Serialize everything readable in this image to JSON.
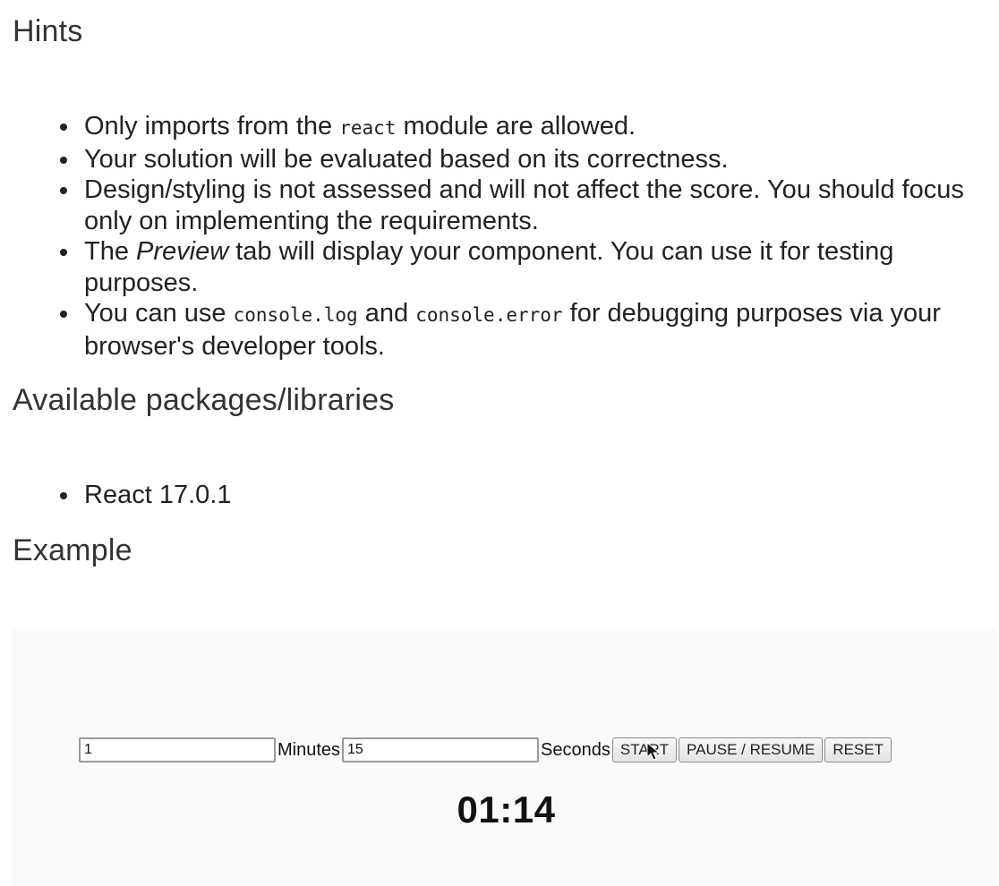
{
  "sections": {
    "hints_title": "Hints",
    "packages_title": "Available packages/libraries",
    "example_title": "Example"
  },
  "hints": {
    "item1": {
      "before": "Only imports from the ",
      "code": "react",
      "after": " module are allowed."
    },
    "item2": {
      "text": "Your solution will be evaluated based on its correctness."
    },
    "item3": {
      "text": "Design/styling is not assessed and will not affect the score. You should focus only on implementing the requirements."
    },
    "item4": {
      "before": "The ",
      "em": "Preview",
      "after": " tab will display your component. You can use it for testing purposes."
    },
    "item5": {
      "before": "You can use ",
      "code1": "console.log",
      "middle": " and ",
      "code2": "console.error",
      "after": " for debugging purposes via your browser's developer tools."
    }
  },
  "packages": [
    "React 17.0.1"
  ],
  "example": {
    "minutes_value": "1",
    "minutes_label": "Minutes",
    "seconds_value": "15",
    "seconds_label": "Seconds",
    "start_label": "START",
    "pause_label": "PAUSE / RESUME",
    "reset_label": "RESET",
    "display": "01:14"
  },
  "icons": {
    "cursor": "mouse-pointer-icon"
  }
}
